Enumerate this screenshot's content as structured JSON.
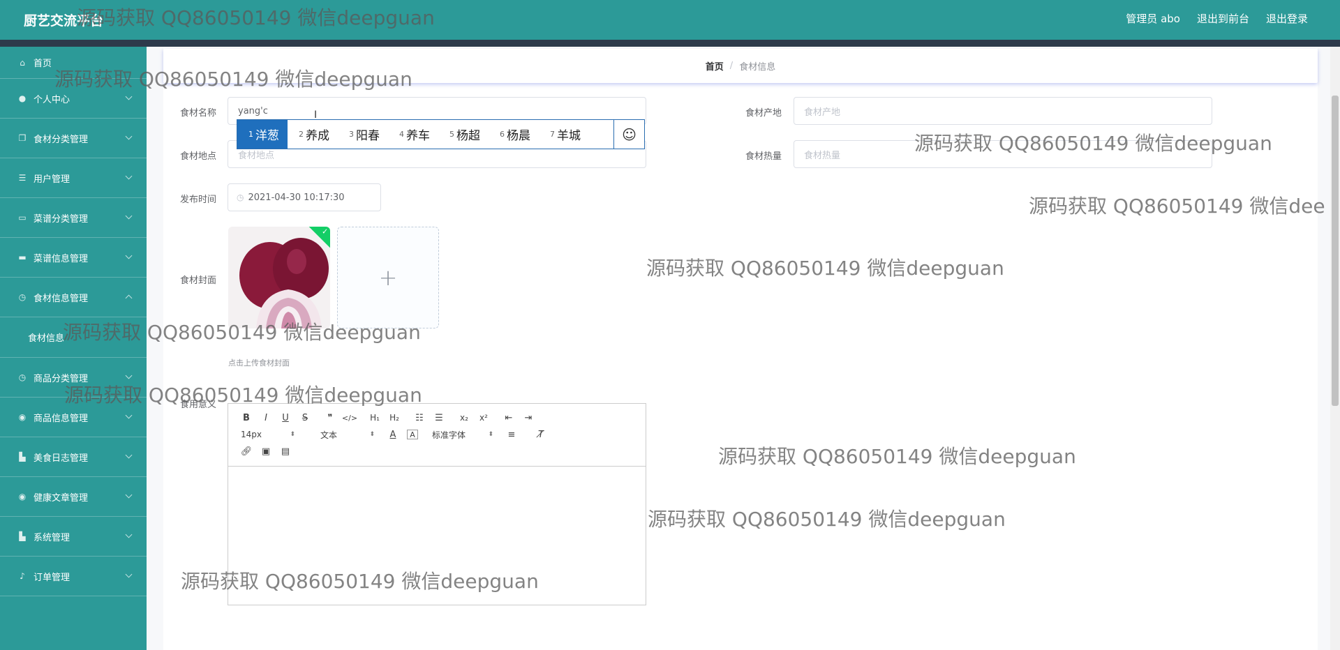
{
  "header": {
    "brand": "厨艺交流平台",
    "admin": "管理员 abo",
    "to_front": "退出到前台",
    "logout": "退出登录"
  },
  "sidebar": {
    "items": [
      {
        "label": "首页",
        "icon": "home-icon"
      },
      {
        "label": "个人中心",
        "icon": "user-icon"
      },
      {
        "label": "食材分类管理",
        "icon": "copy-icon"
      },
      {
        "label": "用户管理",
        "icon": "list-icon"
      },
      {
        "label": "菜谱分类管理",
        "icon": "chat-icon"
      },
      {
        "label": "菜谱信息管理",
        "icon": "monitor-icon"
      },
      {
        "label": "食材信息管理",
        "icon": "clock-icon"
      },
      {
        "label": "商品分类管理",
        "icon": "clock-icon"
      },
      {
        "label": "商品信息管理",
        "icon": "compass-icon"
      },
      {
        "label": "美食日志管理",
        "icon": "bar-icon"
      },
      {
        "label": "健康文章管理",
        "icon": "compass-icon"
      },
      {
        "label": "系统管理",
        "icon": "bar-icon"
      },
      {
        "label": "订单管理",
        "icon": "mic-icon"
      }
    ],
    "submenu_label": "食材信息"
  },
  "breadcrumb": {
    "home": "首页",
    "separator": "/",
    "current": "食材信息"
  },
  "form": {
    "name_label": "食材名称",
    "name_value": "yang'c",
    "origin_label": "食材产地",
    "origin_placeholder": "食材产地",
    "location_label": "食材地点",
    "location_placeholder": "食材地点",
    "calorie_label": "食材热量",
    "calorie_placeholder": "食材热量",
    "time_label": "发布时间",
    "time_value": "2021-04-30 10:17:30",
    "cover_label": "食材封面",
    "cover_hint": "点击上传食材封面",
    "effect_label": "食用意义"
  },
  "ime": {
    "candidates": [
      {
        "num": "1",
        "text": "洋葱"
      },
      {
        "num": "2",
        "text": "养成"
      },
      {
        "num": "3",
        "text": "阳春"
      },
      {
        "num": "4",
        "text": "养车"
      },
      {
        "num": "5",
        "text": "杨超"
      },
      {
        "num": "6",
        "text": "杨晨"
      },
      {
        "num": "7",
        "text": "羊城"
      }
    ],
    "emoji": "☺"
  },
  "editor": {
    "font_size": "14px",
    "header": "文本",
    "font": "标准字体"
  },
  "watermark": "源码获取 QQ86050149 微信deepguan",
  "watermark_partial": "源码获取 QQ86050149 微信dee"
}
